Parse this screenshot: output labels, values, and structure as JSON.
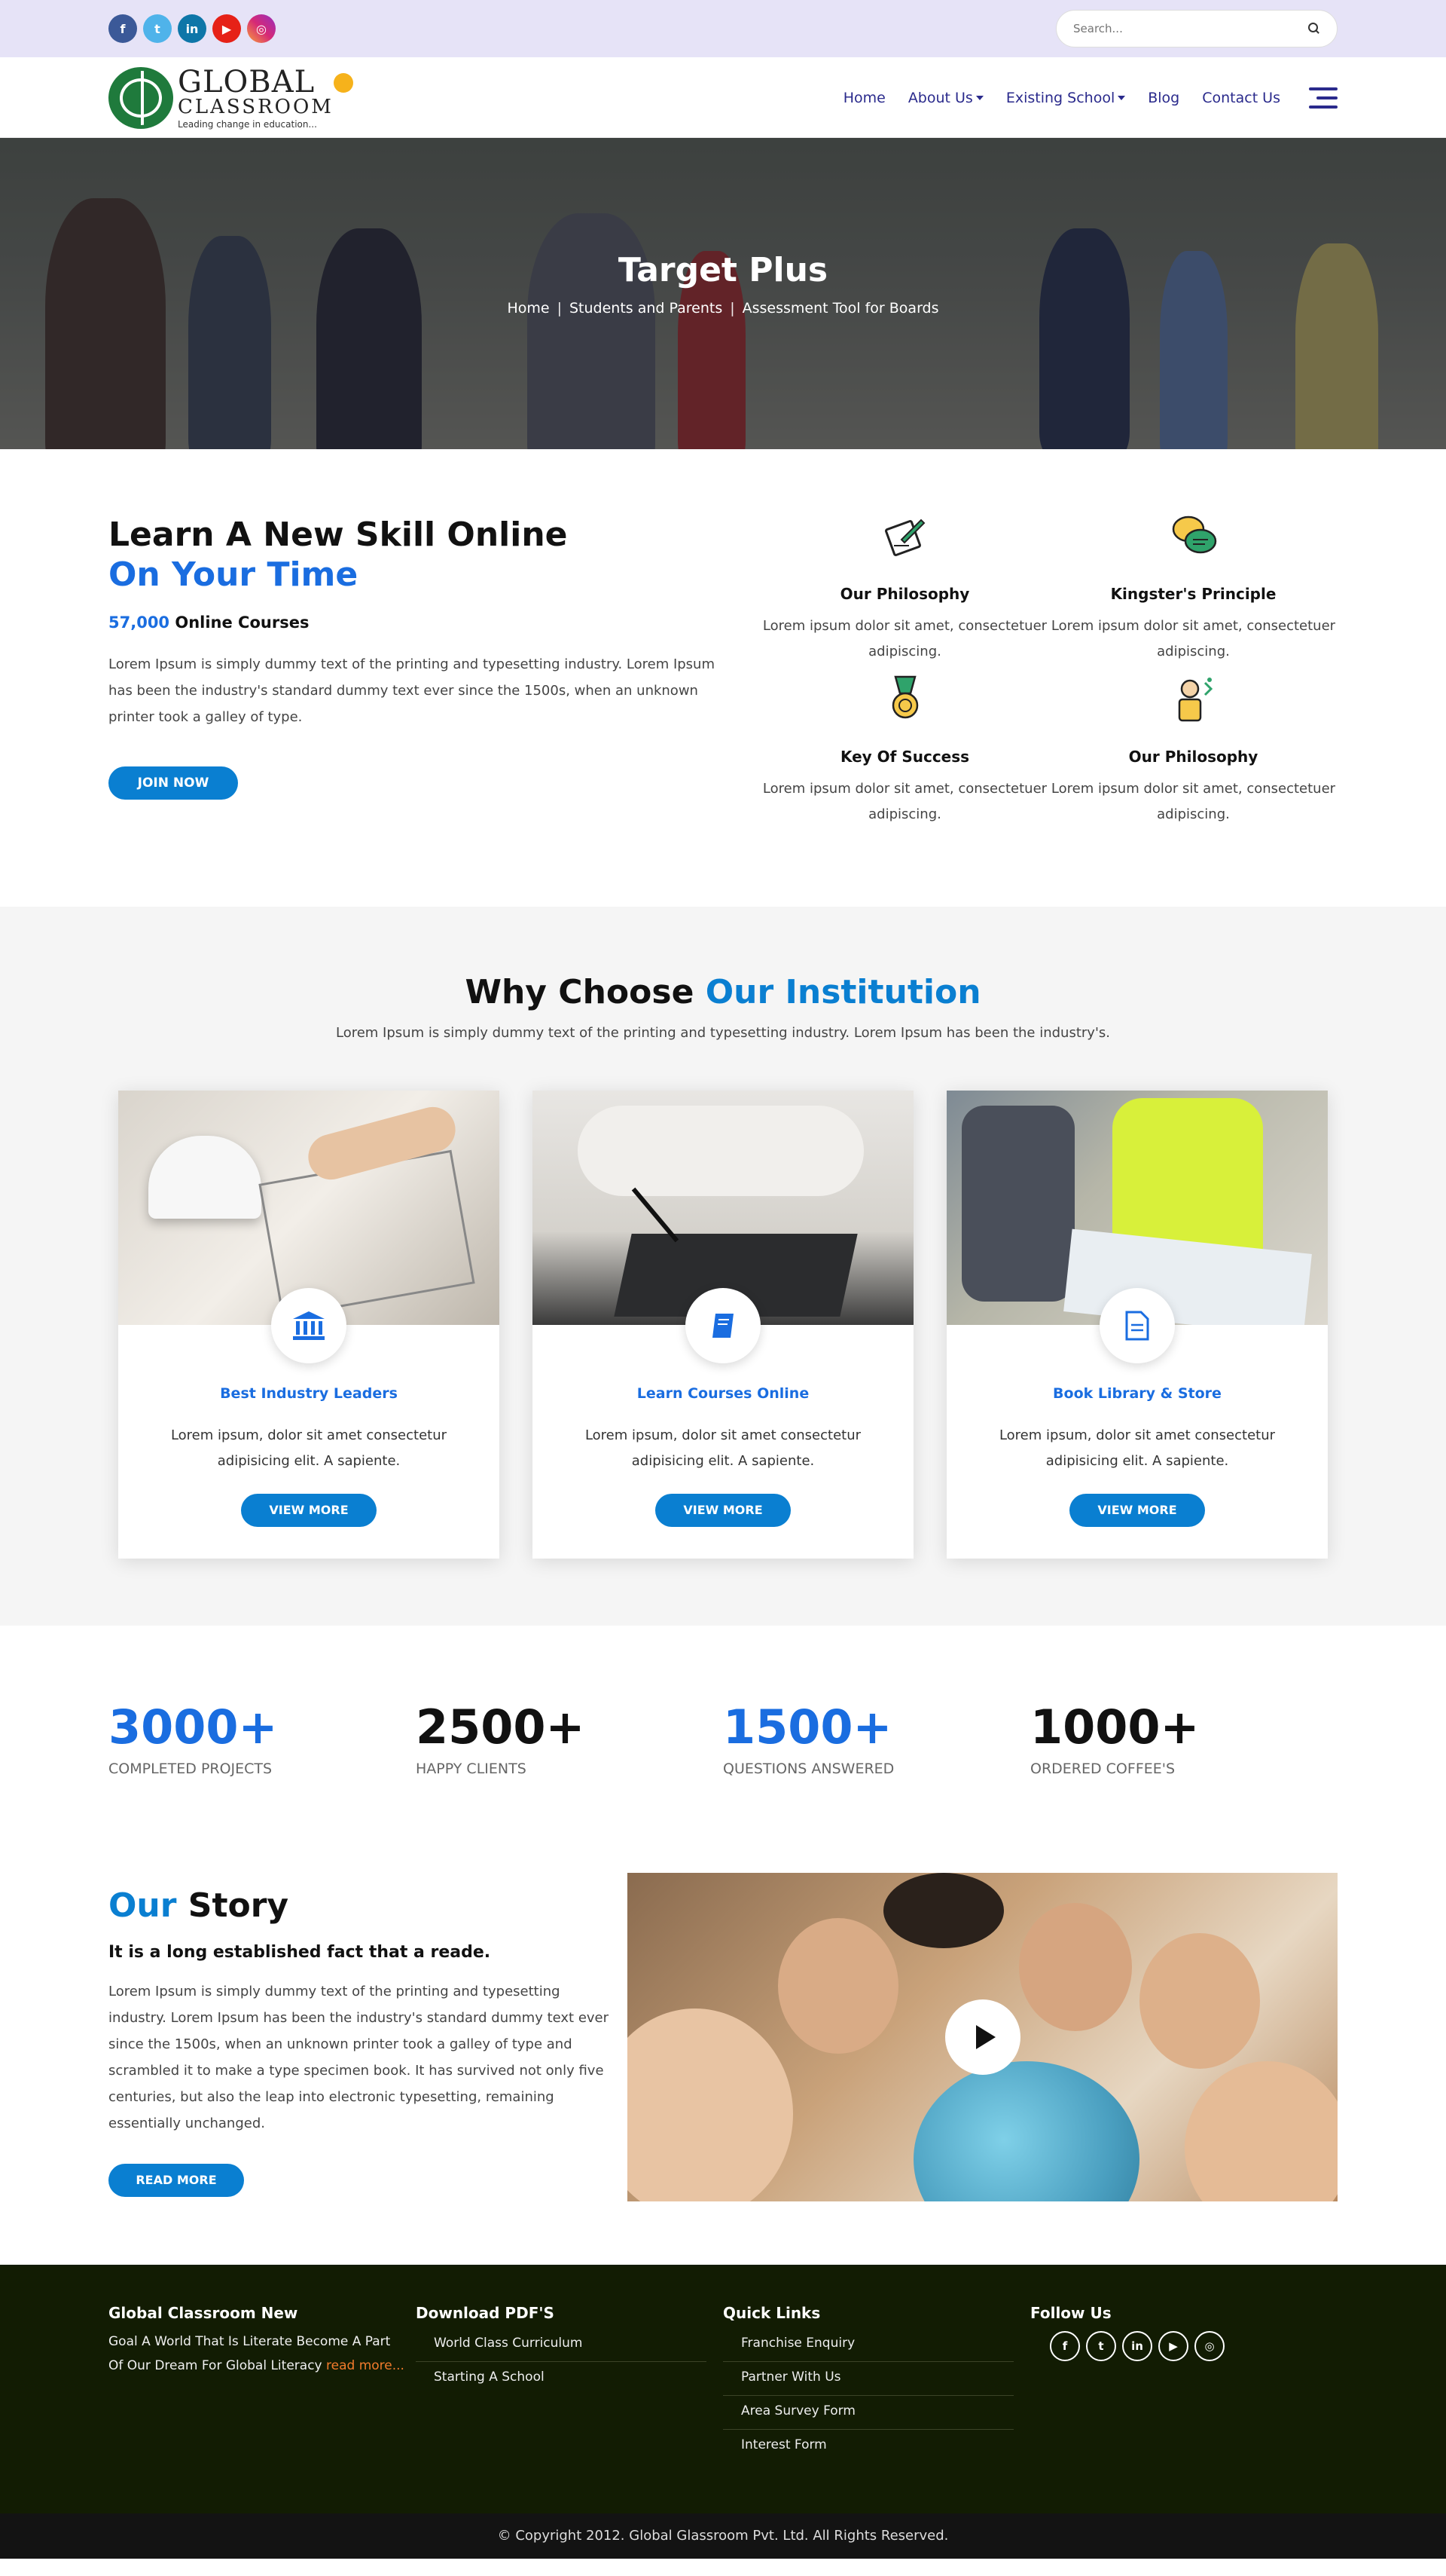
{
  "topbar": {
    "social": [
      "facebook-icon",
      "twitter-icon",
      "linkedin-icon",
      "youtube-icon",
      "instagram-icon"
    ],
    "search_placeholder": "Search..."
  },
  "logo": {
    "main": "GLOBAL",
    "sub": "CLASSROOM",
    "tagline": "Leading change in education..."
  },
  "nav": {
    "home": "Home",
    "about": "About Us",
    "existing": "Existing School",
    "blog": "Blog",
    "contact": "Contact Us"
  },
  "hero": {
    "title": "Target Plus",
    "crumbs": [
      "Home",
      "Students and Parents",
      "Assessment Tool for Boards"
    ]
  },
  "learn": {
    "heading1": "Learn A New Skill Online",
    "heading2": "On Your Time",
    "count": "57,000",
    "count_label": "Online Courses",
    "text": "Lorem Ipsum is simply dummy text of the printing and typesetting industry. Lorem Ipsum has been the industry's standard dummy text ever since the 1500s, when an unknown printer took a galley of type.",
    "button": "JOIN NOW",
    "features": [
      {
        "title": "Our Philosophy",
        "text": "Lorem ipsum dolor sit amet, consectetuer adipiscing."
      },
      {
        "title": "Kingster's Principle",
        "text": "Lorem ipsum dolor sit amet, consectetuer adipiscing."
      },
      {
        "title": "Key Of Success",
        "text": "Lorem ipsum dolor sit amet, consectetuer adipiscing."
      },
      {
        "title": "Our Philosophy",
        "text": "Lorem ipsum dolor sit amet, consectetuer adipiscing."
      }
    ]
  },
  "why": {
    "title_a": "Why Choose",
    "title_b": "Our Institution",
    "subtitle": "Lorem Ipsum is simply dummy text of the printing and typesetting industry. Lorem Ipsum has been the industry's.",
    "cards": [
      {
        "icon": "bank-icon",
        "title": "Best Industry Leaders",
        "text": "Lorem ipsum, dolor sit amet consectetur adipisicing elit. A sapiente.",
        "button": "VIEW MORE"
      },
      {
        "icon": "book-icon",
        "title": "Learn Courses Online",
        "text": "Lorem ipsum, dolor sit amet consectetur adipisicing elit. A sapiente.",
        "button": "VIEW MORE"
      },
      {
        "icon": "document-icon",
        "title": "Book Library & Store",
        "text": "Lorem ipsum, dolor sit amet consectetur adipisicing elit. A sapiente.",
        "button": "VIEW MORE"
      }
    ]
  },
  "stats": [
    {
      "value": "3000+",
      "label": "COMPLETED PROJECTS"
    },
    {
      "value": "2500+",
      "label": "HAPPY CLIENTS"
    },
    {
      "value": "1500+",
      "label": "QUESTIONS ANSWERED"
    },
    {
      "value": "1000+",
      "label": "ORDERED COFFEE'S"
    }
  ],
  "story": {
    "title_a": "Our",
    "title_b": "Story",
    "subtitle": "It is a long established fact that a reade.",
    "text": "Lorem Ipsum is simply dummy text of the printing and typesetting industry. Lorem Ipsum has been the industry's standard dummy text ever since the 1500s, when an unknown printer took a galley of type and scrambled it to make a type specimen book. It has survived not only five centuries, but also the leap into electronic typesetting, remaining essentially unchanged.",
    "button": "READ MORE"
  },
  "footer": {
    "col1_title": "Global Classroom New",
    "col1_text": "Goal A World That Is Literate Become A Part Of Our Dream For Global Literacy",
    "col1_link": "read more...",
    "col2_title": "Download PDF'S",
    "col2_links": [
      "World Class Curriculum",
      "Starting A School"
    ],
    "col3_title": "Quick Links",
    "col3_links": [
      "Franchise Enquiry",
      "Partner With Us",
      "Area Survey Form",
      "Interest Form"
    ],
    "col4_title": "Follow Us",
    "copyright": "© Copyright 2012. Global Glassroom Pvt. Ltd. All Rights Reserved."
  },
  "colors": {
    "accent": "#0a7fd1",
    "heading_blue": "#1a6de0",
    "nav": "#2a2a8c",
    "footer": "#121c03"
  }
}
